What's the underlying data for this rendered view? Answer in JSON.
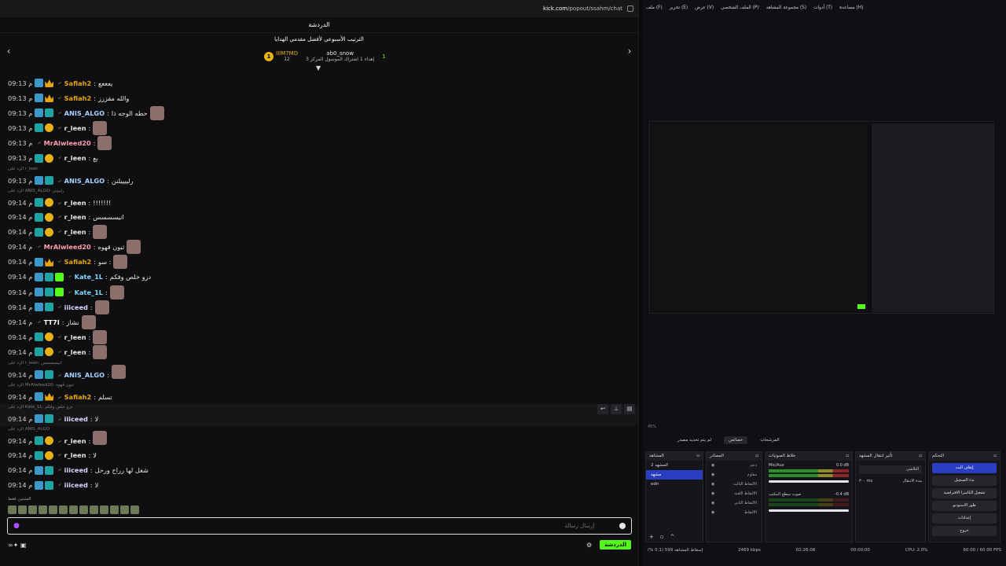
{
  "browser": {
    "url_host": "kick.com",
    "url_path": "/popout/ssahm/chat"
  },
  "chat": {
    "header": "الدردشة",
    "leaderboard": {
      "title": "الترتيب الأسبوعي لأفضل مقدمي الهدايا",
      "entries": [
        {
          "name": "IIIM7MD",
          "count": "12"
        },
        {
          "name": "ab0_snow",
          "sub": "إهداء 1 اشتراك الموسول المركز 3"
        },
        {
          "rank": "1"
        }
      ]
    },
    "messages": [
      {
        "time": "09:13 م",
        "user": "Safiah2",
        "color": "#e7a516",
        "badges": [
          "vip",
          "crown"
        ],
        "text": "يعععع"
      },
      {
        "time": "09:13 م",
        "user": "Safiah2",
        "color": "#e7a516",
        "badges": [
          "vip",
          "crown"
        ],
        "text": "والله مقززز"
      },
      {
        "time": "09:13 م",
        "user": "ANIS_ALGO",
        "color": "#a6d2ff",
        "badges": [
          "vip",
          "sub"
        ],
        "text": "حطه الوجه ذا",
        "emote": true
      },
      {
        "time": "09:13 م",
        "user": "r_leen",
        "color": "#e6e6e6",
        "badges": [
          "sub",
          "coin"
        ],
        "text": "",
        "emote": true
      },
      {
        "time": "09:13 م",
        "user": "MrAlwleed20",
        "color": "#ff9db0",
        "badges": [],
        "text": "",
        "emote": true
      },
      {
        "time": "09:13 م",
        "user": "r_leen",
        "color": "#e6e6e6",
        "badges": [
          "sub",
          "coin"
        ],
        "text": "بع"
      },
      {
        "time": "09:13 م",
        "user": "ANIS_ALGO",
        "color": "#a6d2ff",
        "badges": [
          "vip",
          "sub"
        ],
        "text": "رلييييلنن",
        "reply": "الرد على r_leen"
      },
      {
        "time": "09:14 م",
        "user": "r_leen",
        "color": "#e6e6e6",
        "badges": [
          "sub",
          "coin"
        ],
        "text": "!!!!!!!",
        "reply": "الرد على ANIS_ALGO: رلييينن"
      },
      {
        "time": "09:14 م",
        "user": "r_leen",
        "color": "#e6e6e6",
        "badges": [
          "sub",
          "coin"
        ],
        "text": "انيسسسس"
      },
      {
        "time": "09:14 م",
        "user": "r_leen",
        "color": "#e6e6e6",
        "badges": [
          "sub",
          "coin"
        ],
        "text": "",
        "emote": true
      },
      {
        "time": "09:14 م",
        "user": "MrAlwleed20",
        "color": "#ff9db0",
        "badges": [],
        "text": "ثبون قهوه",
        "emote": true
      },
      {
        "time": "09:14 م",
        "user": "Safiah2",
        "color": "#e7a516",
        "badges": [
          "vip",
          "crown"
        ],
        "text": "سو :",
        "emote": true
      },
      {
        "time": "09:14 م",
        "user": "Kate_1L",
        "color": "#7cd9ff",
        "badges": [
          "vip",
          "sub",
          "green"
        ],
        "text": "دزو خلص وفكم"
      },
      {
        "time": "09:14 م",
        "user": "Kate_1L",
        "color": "#7cd9ff",
        "badges": [
          "vip",
          "sub",
          "green"
        ],
        "text": "",
        "emote": true
      },
      {
        "time": "09:14 م",
        "user": "iiiceed",
        "color": "#d8d8ff",
        "badges": [
          "vip",
          "sub"
        ],
        "text": "",
        "emote": true
      },
      {
        "time": "09:14 م",
        "user": "TT7I",
        "color": "#ffffff",
        "badges": [],
        "text": "نشاز",
        "emote": true
      },
      {
        "time": "09:14 م",
        "user": "r_leen",
        "color": "#e6e6e6",
        "badges": [
          "sub",
          "coin"
        ],
        "text": "",
        "emote": true
      },
      {
        "time": "09:14 م",
        "user": "r_leen",
        "color": "#e6e6e6",
        "badges": [
          "sub",
          "coin"
        ],
        "text": "",
        "emote": true
      },
      {
        "time": "09:14 م",
        "user": "ANIS_ALGO",
        "color": "#a6d2ff",
        "badges": [
          "vip",
          "sub"
        ],
        "text": "",
        "emote": true,
        "reply": "الرد على r_leen: انيسسسس"
      },
      {
        "time": "09:14 م",
        "user": "Safiah2",
        "color": "#e7a516",
        "badges": [
          "vip",
          "crown"
        ],
        "text": "تسلم",
        "reply": "الرد على MrAlwleed20: ثبون قهوه"
      },
      {
        "time": "09:14 م",
        "user": "iiiceed",
        "color": "#d8d8ff",
        "badges": [
          "vip",
          "sub"
        ],
        "text": "لا",
        "reply": "الرد على Kate_1L: دزو خلص وفكم",
        "highlight": true
      },
      {
        "time": "09:14 م",
        "user": "r_leen",
        "color": "#e6e6e6",
        "badges": [
          "sub",
          "coin"
        ],
        "text": "",
        "emote": true,
        "reply": "الرد على ANIS_ALGO"
      },
      {
        "time": "09:14 م",
        "user": "r_leen",
        "color": "#e6e6e6",
        "badges": [
          "sub",
          "coin"
        ],
        "text": "لا"
      },
      {
        "time": "09:14 م",
        "user": "iiiceed",
        "color": "#d8d8ff",
        "badges": [
          "vip",
          "sub"
        ],
        "text": "شغل لها رراح ورحل"
      },
      {
        "time": "09:14 م",
        "user": "iiiceed",
        "color": "#d8d8ff",
        "badges": [
          "vip",
          "sub"
        ],
        "text": "لا"
      }
    ],
    "pinned_label": "المثبتين فقط",
    "input_placeholder": "إرسال رسالة",
    "send_label": "الدردشة"
  },
  "obs": {
    "menu": [
      "ملف (F)",
      "تحرير (E)",
      "عرض (V)",
      "الملف الشخصي (P)",
      "مجموعة المشاهد (S)",
      "أدوات (T)",
      "مساعدة (H)"
    ],
    "zoom": "45%",
    "tabs": [
      "لم يتم تحديد مصدر",
      "خصائص",
      "المرشحات"
    ],
    "docks": {
      "scenes": {
        "title": "المشاهد",
        "items": [
          "المشهد 2",
          "مشهد",
          "edn"
        ],
        "selected": 1
      },
      "sources": {
        "title": "المصادر",
        "items": [
          "دعم",
          "مقاوم",
          "الالتقاط الثالث",
          "الالتقاط اللعبة",
          "الالتقاط الثاني",
          "الالتقاط"
        ]
      },
      "mixer": {
        "title": "خلاط الصوتيات",
        "channels": [
          {
            "name": "Mic/Aux",
            "db": "0.0 dB"
          },
          {
            "name": "صوت سطح المكتب",
            "db": "-0.4 dB"
          }
        ]
      },
      "transitions": {
        "title": "تأثير انتقال المشهد",
        "value": "التلاشي",
        "duration": "٣٠٠ ms",
        "duration_label": "مدة الانتقال"
      },
      "controls": {
        "title": "التحكم",
        "buttons": [
          "إيقاف البث",
          "بدء التسجيل",
          "تشغيل الكاميرا الافتراضية",
          "طور الاستوديو",
          "إعدادات",
          "خروج"
        ]
      }
    },
    "status": {
      "dropped": "إسقاط المشاهد 599 (0.1 %)",
      "bitrate": "2469 kbps",
      "live_time": "02:26:08",
      "rec_time": "00:00:00",
      "cpu": "CPU: 2.0%",
      "fps": "60.00 / 60.00 FPS"
    },
    "accent": "#2a3ec4"
  },
  "colors": {
    "kick_green": "#53fc18",
    "gold": "#e7b116"
  }
}
